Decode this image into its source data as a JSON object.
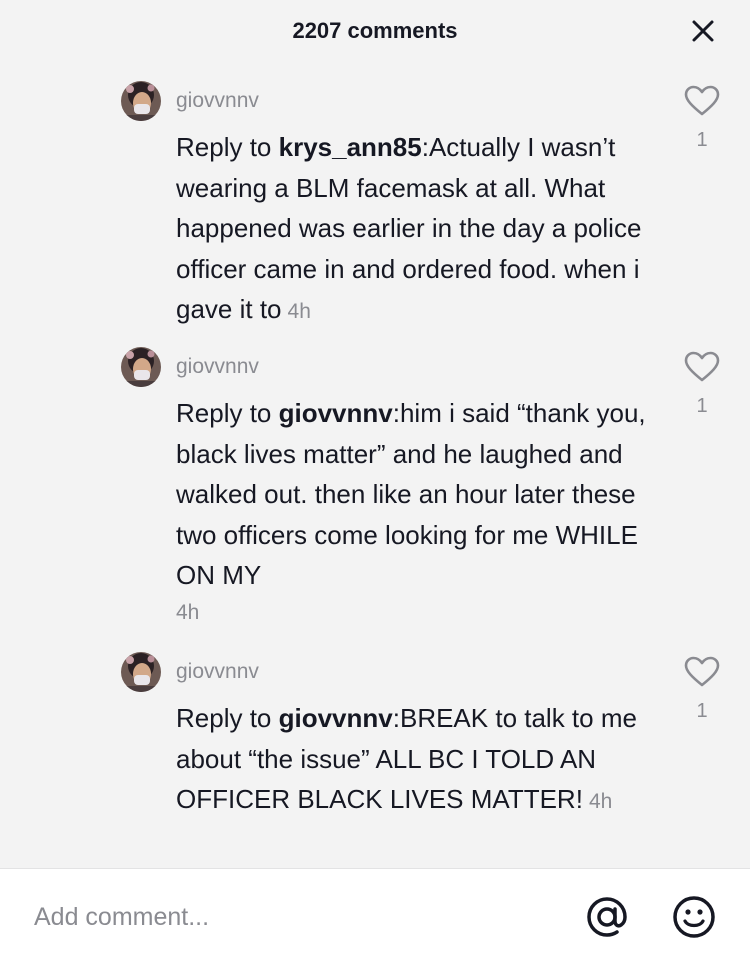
{
  "header": {
    "title": "2207 comments",
    "close_icon": "close-icon"
  },
  "comments": [
    {
      "username": "giovvnnv",
      "reply_prefix": "Reply to ",
      "reply_target": "krys_ann85",
      "text": ":Actually I wasn’t wearing a BLM facemask at all. What happened was earlier in the day a police officer came in and ordered food. when i gave it to",
      "time": "4h",
      "likes": "1"
    },
    {
      "username": "giovvnnv",
      "reply_prefix": "Reply to ",
      "reply_target": "giovvnnv",
      "text": ":him i said “thank you, black lives matter” and he laughed and walked out. then like an hour later these two officers come looking for me WHILE ON MY",
      "time": "4h",
      "likes": "1"
    },
    {
      "username": "giovvnnv",
      "reply_prefix": "Reply to ",
      "reply_target": "giovvnnv",
      "text": ":BREAK to talk to me about “the issue” ALL BC I TOLD AN OFFICER BLACK LIVES MATTER!",
      "time": "4h",
      "likes": "1"
    }
  ],
  "footer": {
    "placeholder": "Add comment...",
    "mention_icon": "at-sign-icon",
    "emoji_icon": "emoji-icon"
  },
  "colors": {
    "background": "#f3f3f3",
    "text_primary": "#161823",
    "text_secondary": "#8a8b91",
    "footer_bg": "#ffffff"
  }
}
